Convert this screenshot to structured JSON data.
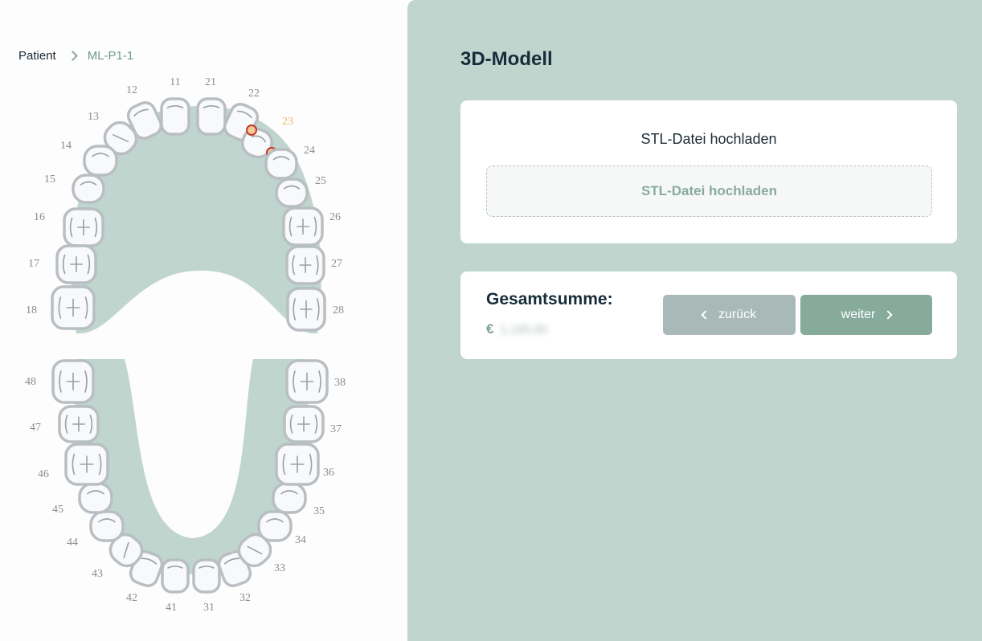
{
  "breadcrumb": {
    "root": "Patient",
    "current": "ML-P1-1"
  },
  "tooth_chart": {
    "selected_tooth": "23",
    "upper_right": [
      "11",
      "12",
      "13",
      "14",
      "15",
      "16",
      "17",
      "18"
    ],
    "upper_left": [
      "21",
      "22",
      "23",
      "24",
      "25",
      "26",
      "27",
      "28"
    ],
    "lower_left": [
      "31",
      "32",
      "33",
      "34",
      "35",
      "36",
      "37",
      "38"
    ],
    "lower_right": [
      "41",
      "42",
      "43",
      "44",
      "45",
      "46",
      "47",
      "48"
    ]
  },
  "section": {
    "title": "3D-Modell"
  },
  "upload": {
    "heading": "STL-Datei hochladen",
    "zone_label": "STL-Datei hochladen"
  },
  "total": {
    "label": "Gesamtsumme:",
    "currency": "€",
    "amount": "1.195,00"
  },
  "buttons": {
    "back": "zurück",
    "next": "weiter"
  },
  "colors": {
    "panel": "#bfd5cd",
    "accent": "#86ab9d",
    "selected": "#f0b56a",
    "title": "#162c3a"
  }
}
